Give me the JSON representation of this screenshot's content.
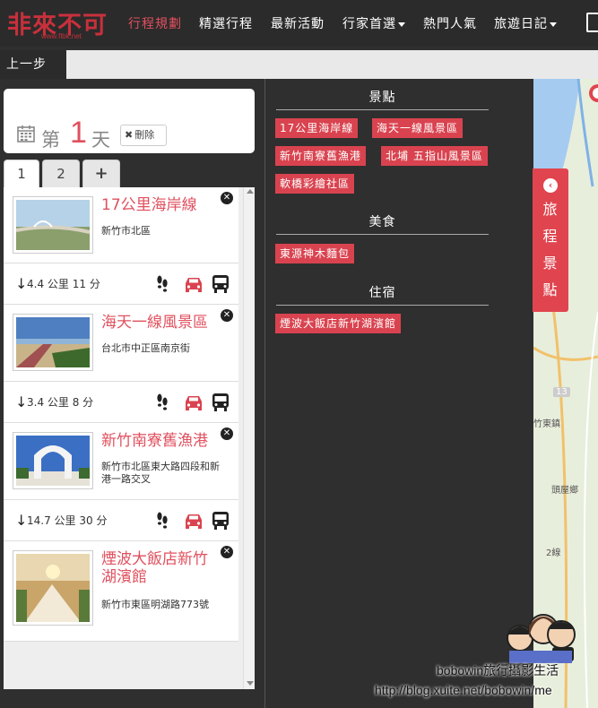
{
  "logo": {
    "text": "非來不可",
    "url": "www.flbk.net"
  },
  "nav": [
    {
      "label": "行程規劃",
      "active": true,
      "dropdown": false
    },
    {
      "label": "精選行程",
      "active": false,
      "dropdown": false
    },
    {
      "label": "最新活動",
      "active": false,
      "dropdown": false
    },
    {
      "label": "行家首選",
      "active": false,
      "dropdown": true
    },
    {
      "label": "熱門人氣",
      "active": false,
      "dropdown": false
    },
    {
      "label": "旅遊日記",
      "active": false,
      "dropdown": true
    }
  ],
  "back_label": "上一步",
  "day": {
    "prefix": "第",
    "number": "1",
    "suffix": "天",
    "delete_label": "刪除"
  },
  "tabs": [
    "1",
    "2",
    "+"
  ],
  "places": [
    {
      "name": "17公里海岸線",
      "address": "新竹市北區"
    },
    {
      "name": "海天一線風景區",
      "address": "台北市中正區南京街"
    },
    {
      "name": "新竹南寮舊漁港",
      "address": "新竹市北區東大路四段和新港一路交叉"
    },
    {
      "name": "煙波大飯店新竹湖濱館",
      "address": "新竹市東區明湖路773號"
    }
  ],
  "transits": [
    {
      "distance": "4.4 公里",
      "time": "11 分"
    },
    {
      "distance": "3.4 公里",
      "time": "8 分"
    },
    {
      "distance": "14.7 公里",
      "time": "30 分"
    }
  ],
  "sections": {
    "attractions": {
      "title": "景點",
      "items": [
        "17公里海岸線",
        "海天一線風景區",
        "新竹南寮舊漁港",
        "北埔 五指山風景區",
        "軟橋彩繪社區"
      ]
    },
    "food": {
      "title": "美食",
      "items": [
        "東源神木麵包"
      ]
    },
    "lodging": {
      "title": "住宿",
      "items": [
        "煙波大飯店新竹湖濱館"
      ]
    }
  },
  "itinerary_toggle_label": [
    "旅",
    "程",
    "景",
    "點"
  ],
  "map": {
    "labels": [
      "竹東鎮",
      "頭屋鄉",
      "2線",
      "13"
    ]
  },
  "watermark": {
    "line1": "bobowin旅行攝影生活",
    "line2": "http://blog.xuite.net/bobowin/me"
  },
  "colors": {
    "accent": "#e0505e",
    "chip": "#d9434f",
    "panel": "#2f2f2f"
  }
}
